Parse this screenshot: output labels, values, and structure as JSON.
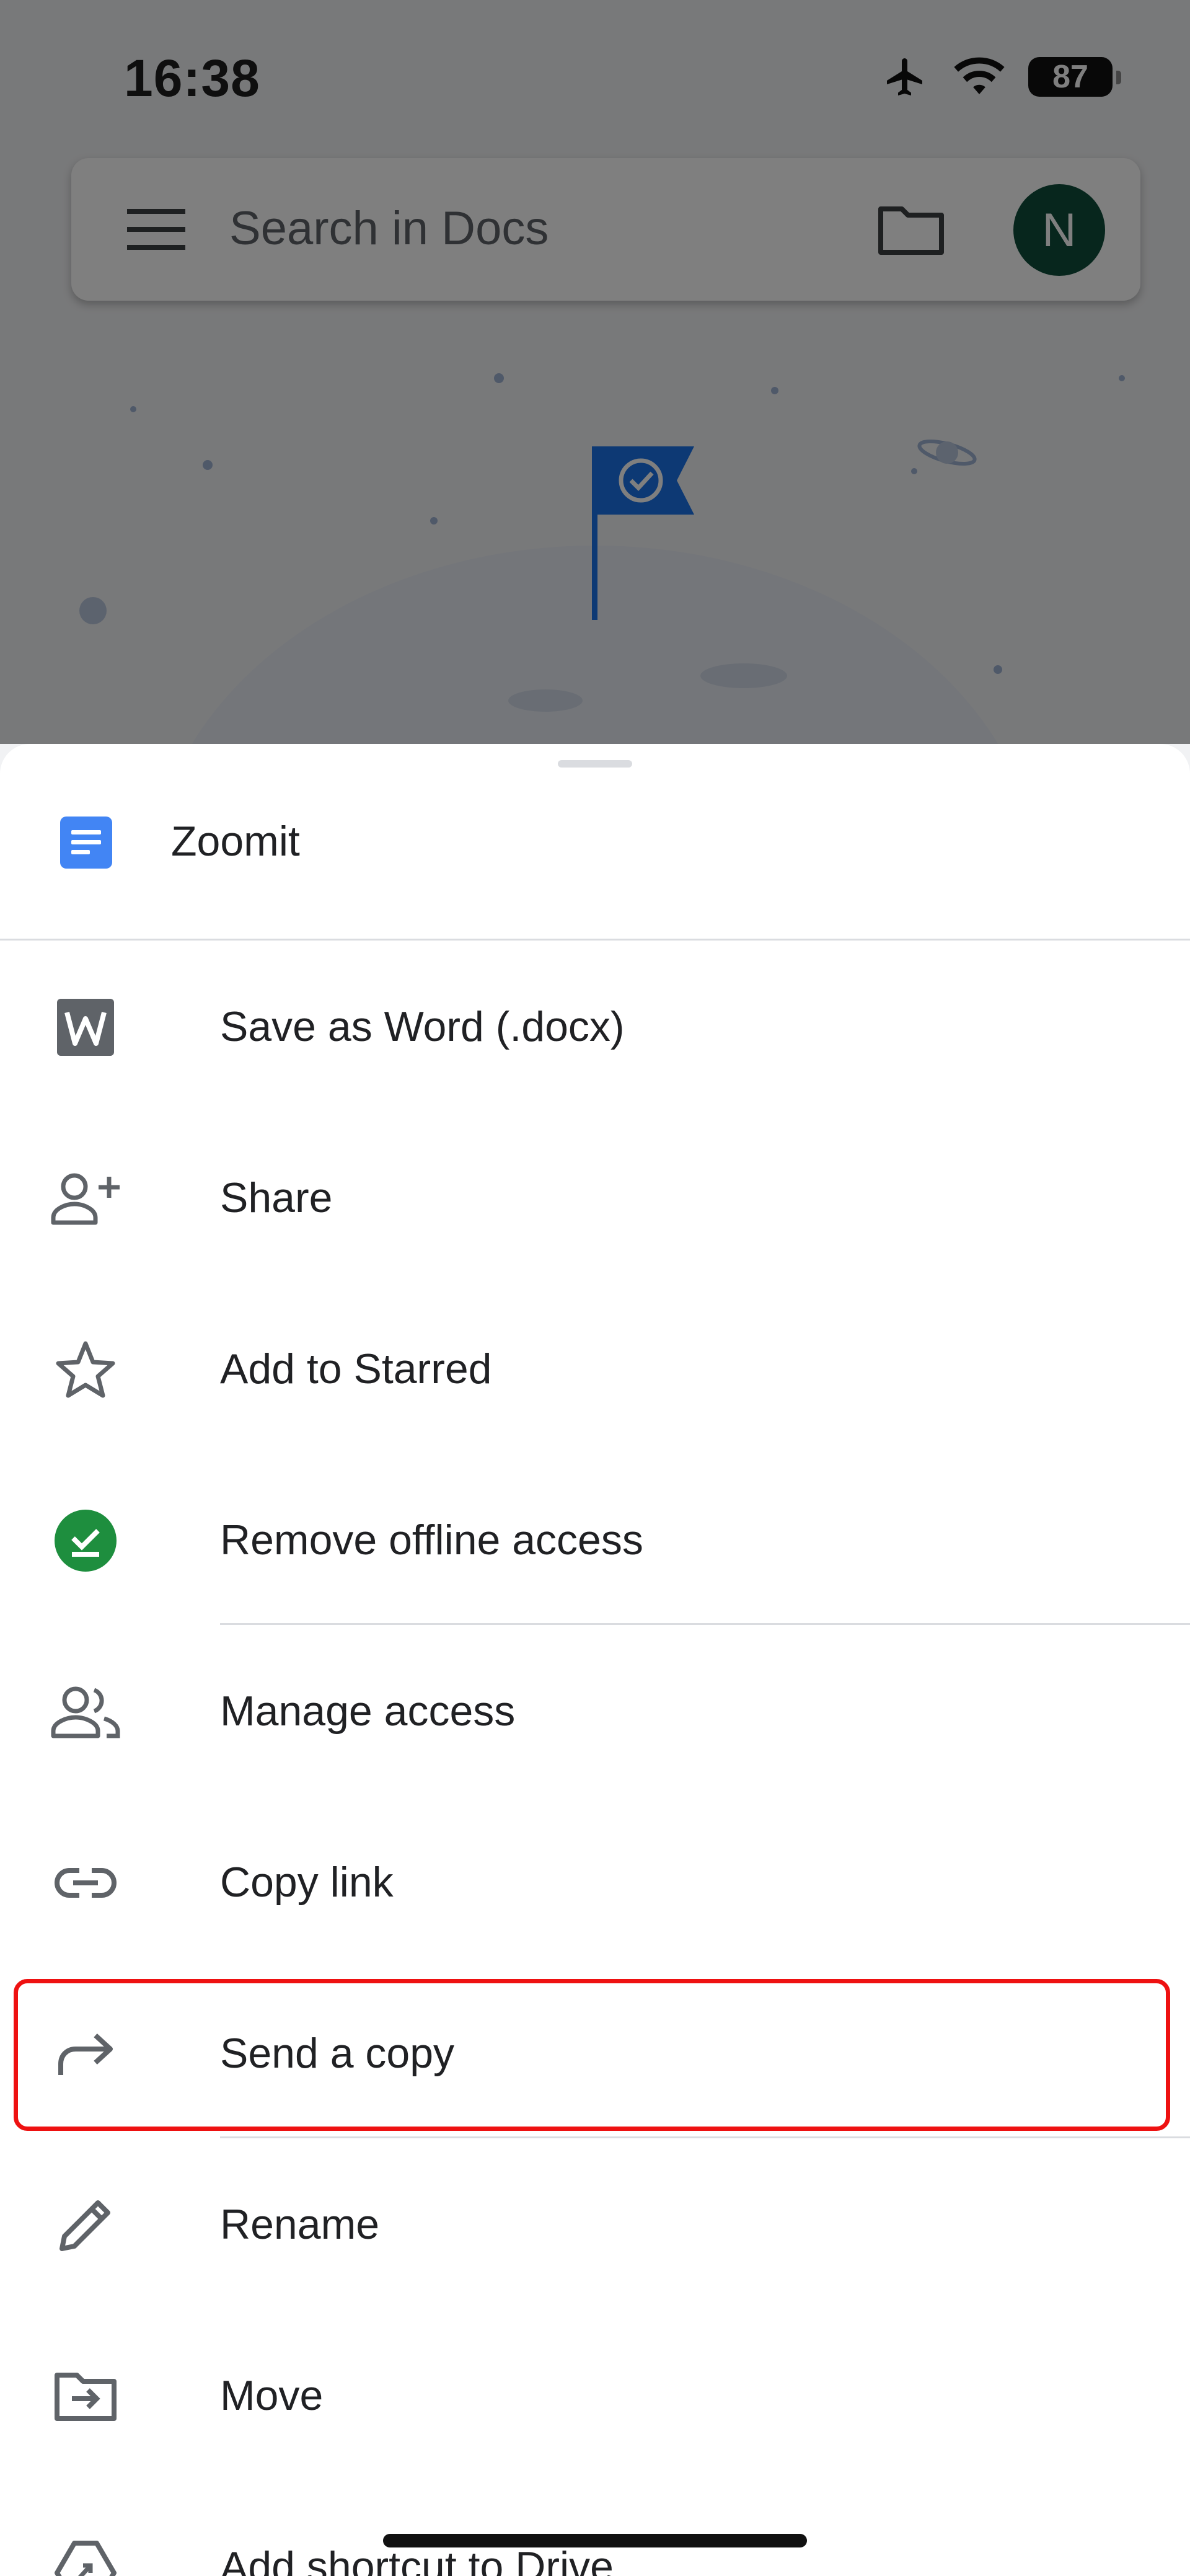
{
  "status_bar": {
    "time": "16:38",
    "battery": "87",
    "icons": [
      "airplane-icon",
      "wifi-icon",
      "battery-icon"
    ]
  },
  "search": {
    "placeholder": "Search in Docs",
    "avatar_initial": "N"
  },
  "sheet": {
    "file_name": "Zoomit",
    "items": [
      {
        "label": "Save as Word (.docx)",
        "icon": "word-icon"
      },
      {
        "label": "Share",
        "icon": "add-person-icon"
      },
      {
        "label": "Add to Starred",
        "icon": "star-icon"
      },
      {
        "label": "Remove offline access",
        "icon": "offline-check-icon"
      },
      {
        "label": "Manage access",
        "icon": "people-icon"
      },
      {
        "label": "Copy link",
        "icon": "link-icon"
      },
      {
        "label": "Send a copy",
        "icon": "send-icon",
        "highlighted": true
      },
      {
        "label": "Rename",
        "icon": "pencil-icon"
      },
      {
        "label": "Move",
        "icon": "move-folder-icon"
      },
      {
        "label": "Add shortcut to Drive",
        "icon": "drive-shortcut-icon"
      }
    ]
  },
  "colors": {
    "highlight": "#ee1111",
    "offline_green": "#1e8e3e",
    "doc_blue": "#4285f4",
    "avatar": "#0f4c3a",
    "flag_blue": "#1a73e8"
  }
}
